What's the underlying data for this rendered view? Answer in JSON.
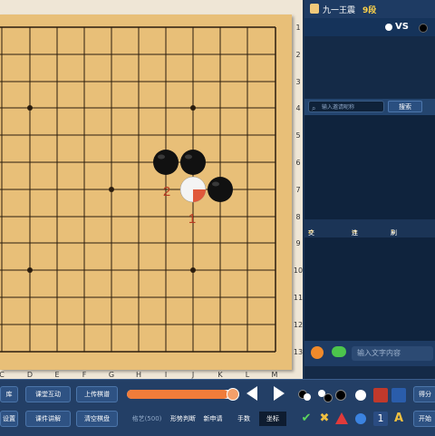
{
  "board": {
    "rank_labels": [
      "1",
      "2",
      "3",
      "4",
      "5",
      "6",
      "7",
      "8",
      "9",
      "10",
      "11",
      "12",
      "13"
    ],
    "file_labels": [
      "C",
      "D",
      "E",
      "F",
      "G",
      "H",
      "I",
      "J",
      "K",
      "L",
      "M"
    ],
    "move_labels": [
      "1",
      "2"
    ]
  },
  "player": {
    "name": "九一王震",
    "rank": "9段"
  },
  "vs_label": "VS",
  "search": {
    "placeholder": "输入邀请昵称",
    "button": "搜索"
  },
  "actions": {
    "swap": "交替落子",
    "consecutive": "连续",
    "refresh": "刷新"
  },
  "chat": {
    "placeholder": "输入文字内容"
  },
  "toolbar": {
    "left_buttons": [
      "库",
      "课堂互动",
      "上传棋谱",
      "设置",
      "课件讲解",
      "清空棋盘"
    ],
    "modes": [
      "格艺(500)",
      "形势判断",
      "新申请",
      "手数",
      "坐标"
    ],
    "right_buttons": [
      "得分",
      "开始"
    ],
    "text_tool": "A"
  },
  "colors": {
    "board": "#e8bf78",
    "panel": "#142a47",
    "accent": "#f07c3a"
  }
}
